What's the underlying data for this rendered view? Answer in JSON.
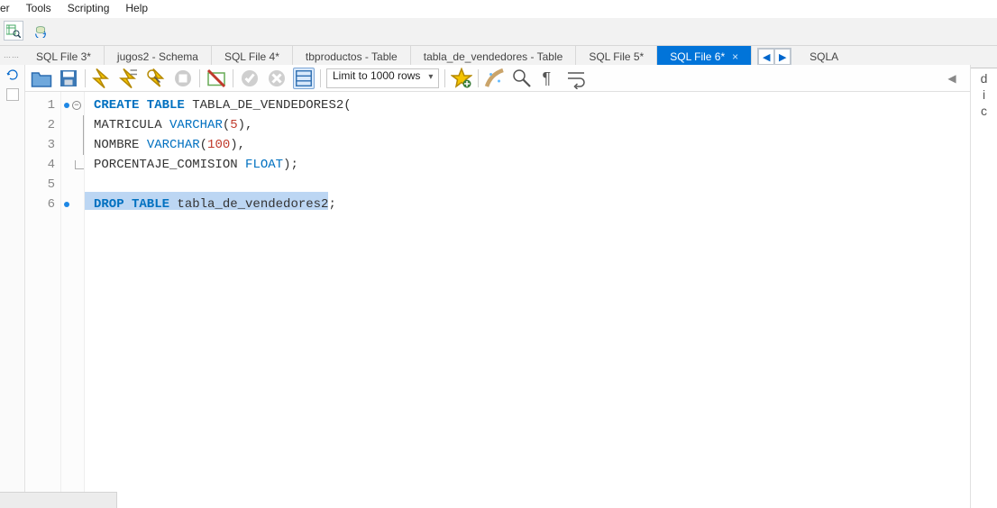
{
  "menu": {
    "items": [
      "er",
      "Tools",
      "Scripting",
      "Help"
    ]
  },
  "tabs": {
    "grip": "⋯⋯",
    "items": [
      {
        "label": "SQL File 3*"
      },
      {
        "label": "jugos2 - Schema"
      },
      {
        "label": "SQL File 4*"
      },
      {
        "label": "tbproductos - Table"
      },
      {
        "label": "tabla_de_vendedores - Table"
      },
      {
        "label": "SQL File 5*"
      }
    ],
    "active": {
      "label": "SQL File 6*",
      "close": "×"
    },
    "nav": {
      "prev": "◀",
      "next": "▶"
    },
    "overflow_label": "SQLA"
  },
  "editor_toolbar": {
    "limit_label": "Limit to 1000 rows"
  },
  "code": {
    "lines": [
      {
        "n": "1",
        "dot": true,
        "fold": "open",
        "tokens": [
          [
            "kw",
            "CREATE TABLE"
          ],
          [
            "sp",
            " "
          ],
          [
            "ident",
            "TABLA_DE_VENDEDORES2"
          ],
          [
            "punct",
            "("
          ]
        ]
      },
      {
        "n": "2",
        "dot": false,
        "fold": "mid",
        "tokens": [
          [
            "ident",
            "MATRICULA"
          ],
          [
            "sp",
            " "
          ],
          [
            "type",
            "VARCHAR"
          ],
          [
            "punct",
            "("
          ],
          [
            "num",
            "5"
          ],
          [
            "punct",
            "),"
          ]
        ]
      },
      {
        "n": "3",
        "dot": false,
        "fold": "mid",
        "tokens": [
          [
            "ident",
            "NOMBRE"
          ],
          [
            "sp",
            " "
          ],
          [
            "type",
            "VARCHAR"
          ],
          [
            "punct",
            "("
          ],
          [
            "num",
            "100"
          ],
          [
            "punct",
            "),"
          ]
        ]
      },
      {
        "n": "4",
        "dot": false,
        "fold": "end",
        "tokens": [
          [
            "ident",
            "PORCENTAJE_COMISION"
          ],
          [
            "sp",
            " "
          ],
          [
            "type",
            "FLOAT"
          ],
          [
            "punct",
            ");"
          ]
        ]
      },
      {
        "n": "5",
        "dot": false,
        "fold": "",
        "tokens": []
      },
      {
        "n": "6",
        "dot": true,
        "fold": "",
        "selected": true,
        "tokens": [
          [
            "kw",
            "DROP TABLE"
          ],
          [
            "sp",
            " "
          ],
          [
            "ident",
            "tabla_de_vendedores2"
          ],
          [
            "punct",
            ";"
          ]
        ]
      }
    ]
  },
  "rightpanel": {
    "arrow": "◀",
    "stub": [
      "d",
      "i",
      "c"
    ]
  }
}
